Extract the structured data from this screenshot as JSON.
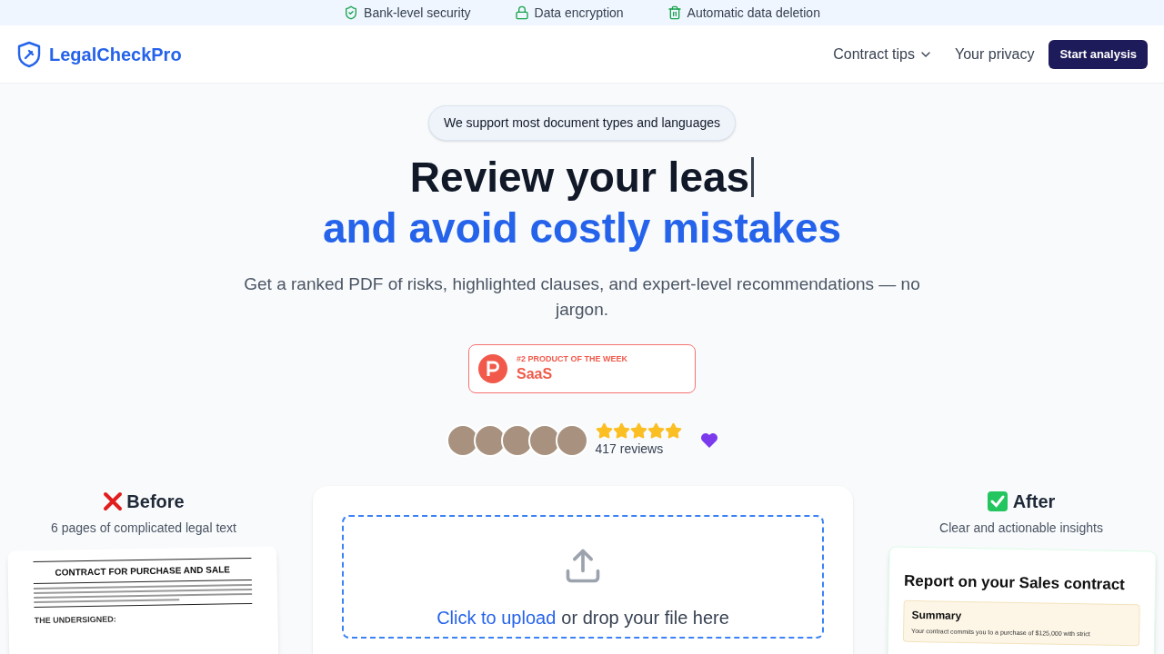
{
  "trust_bar": [
    {
      "kind": "shield",
      "label": "Bank-level security"
    },
    {
      "kind": "lock",
      "label": "Data encryption"
    },
    {
      "kind": "trash",
      "label": "Automatic data deletion"
    }
  ],
  "header": {
    "logo": "LegalCheckPro",
    "nav": [
      {
        "label": "Contract tips",
        "dropdown": true
      },
      {
        "label": "Your privacy",
        "dropdown": false
      }
    ],
    "cta": "Start analysis"
  },
  "hero": {
    "pill": "We support most document types and languages",
    "title_line_1": "Review your leas",
    "typing_cursor": true,
    "title_line_2": "and avoid costly mistakes",
    "subtitle": "Get a ranked PDF of risks, highlighted clauses, and expert-level recommendations — no jargon.",
    "award": {
      "rank": "#2 PRODUCT OF THE WEEK",
      "category": "SaaS"
    },
    "reviews": {
      "avatars": [
        {
          "kind": "photo"
        },
        {
          "kind": "photo"
        },
        {
          "kind": "photo"
        },
        {
          "kind": "photo"
        },
        {
          "kind": "photo"
        }
      ],
      "stars": 5,
      "count": "417 reviews"
    }
  },
  "before": {
    "title": "Before",
    "subtitle": "6 pages of complicated legal text",
    "doc_title": "CONTRACT FOR PURCHASE AND SALE",
    "doc_heading": "THE UNDERSIGNED:"
  },
  "upload": {
    "link": "Click to upload",
    "text": "or drop your file here"
  },
  "after": {
    "title": "After",
    "subtitle": "Clear and actionable insights",
    "report_title": "Report on your Sales contract",
    "summary_title": "Summary",
    "summary_text": "Your contract commits you to a purchase of $125,000 with strict"
  }
}
